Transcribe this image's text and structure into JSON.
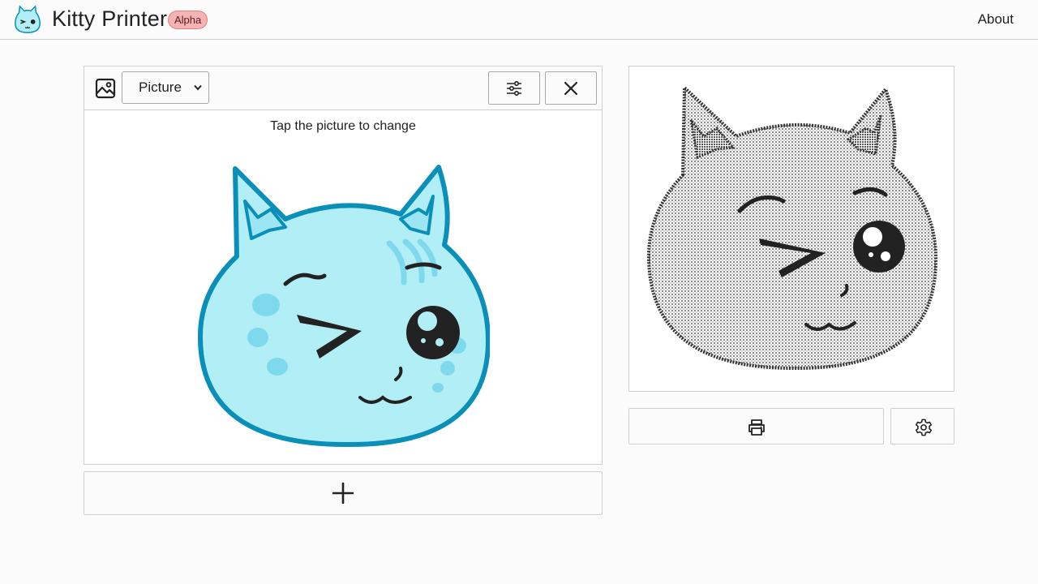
{
  "header": {
    "title": "Kitty Printer",
    "badge": "Alpha",
    "about_label": "About",
    "logo_icon": "kitty-logo-icon"
  },
  "editor": {
    "type_selected": "Picture",
    "hint": "Tap the picture to change",
    "icons": {
      "type": "image-icon",
      "adjust": "sliders-icon",
      "close": "close-icon",
      "add": "plus-icon"
    }
  },
  "preview": {
    "print_icon": "printer-icon",
    "settings_icon": "gear-icon"
  },
  "colors": {
    "badge_bg": "#f6b3b3",
    "badge_border": "#e57f7f",
    "cat_fill": "#b2eef5",
    "cat_stroke": "#0a8fb8",
    "border": "#cfcfcf"
  }
}
